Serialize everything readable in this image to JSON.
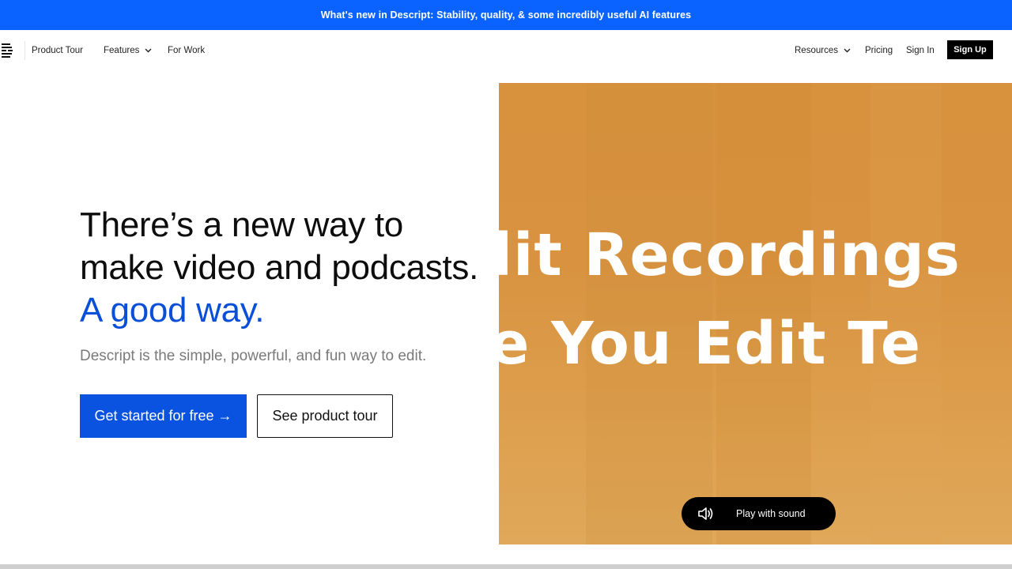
{
  "announcement": "What's new in Descript: Stability, quality, & some incredibly useful AI features",
  "nav": {
    "left_items": [
      {
        "label": "Product Tour"
      },
      {
        "label": "Features"
      },
      {
        "label": "For Work"
      }
    ],
    "right_items": [
      {
        "label": "Resources"
      },
      {
        "label": "Pricing"
      },
      {
        "label": "Sign In"
      }
    ],
    "signup_label": "Sign Up"
  },
  "hero": {
    "title_main": "There’s a new way to make video and podcasts.",
    "title_accent": "A good way.",
    "subtitle": "Descript is the simple, powerful, and fun way to edit.",
    "primary_cta": "Get started for free →",
    "secondary_cta": "See product tour"
  },
  "video": {
    "caption_line1": "dit Recordings",
    "caption_line2": "ke You Edit Te",
    "play_label": "Play with sound"
  },
  "icons": {
    "logo": "descript-logo-icon",
    "chevron": "chevron-down-icon",
    "speaker": "speaker-icon"
  },
  "colors": {
    "announce_bg": "#0a62ff",
    "accent": "#0a4fd8",
    "primary_button": "#0a52e0",
    "video_bg": "#d99340"
  }
}
